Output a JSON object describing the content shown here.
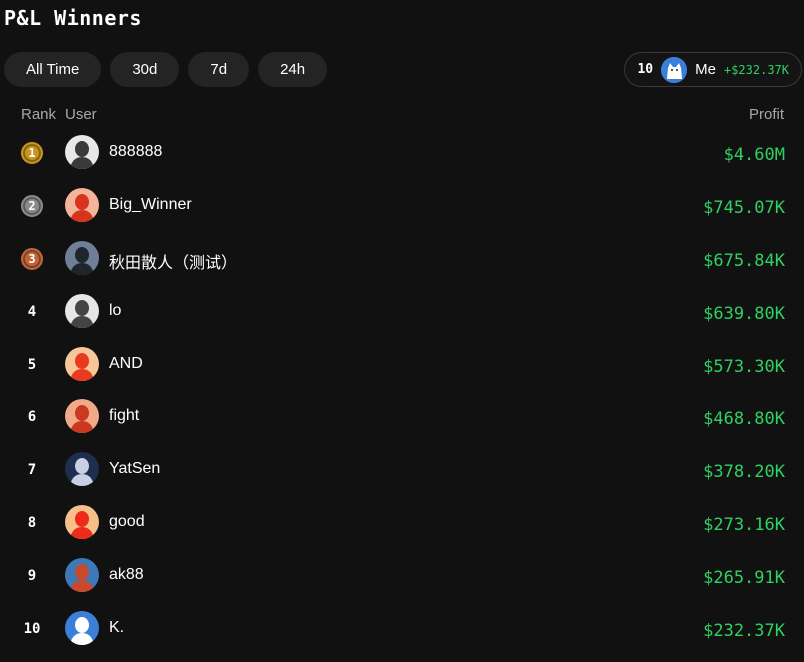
{
  "title": "P&L Winners",
  "filters": [
    {
      "label": "All Time",
      "active": true
    },
    {
      "label": "30d",
      "active": false
    },
    {
      "label": "7d",
      "active": false
    },
    {
      "label": "24h",
      "active": false
    }
  ],
  "me": {
    "rank": "10",
    "label": "Me",
    "profit": "+$232.37K",
    "avatar_icon": "cat-avatar-icon"
  },
  "columns": {
    "rank": "Rank",
    "user": "User",
    "profit": "Profit"
  },
  "colors": {
    "accent": "#f0642f",
    "profit_green": "#2fd162",
    "gold": "#c8961e",
    "silver": "#8a8a8a",
    "bronze": "#c0653a"
  },
  "rows": [
    {
      "rank": "1",
      "medal": "gold",
      "name": "888888",
      "profit": "$4.60M",
      "avatar": {
        "bg": "#e8e8e8",
        "fg": "#3a3a3a"
      }
    },
    {
      "rank": "2",
      "medal": "silver",
      "name": "Big_Winner",
      "profit": "$745.07K",
      "avatar": {
        "bg": "#f4b49a",
        "fg": "#d8331c"
      }
    },
    {
      "rank": "3",
      "medal": "bronze",
      "name": "秋田散人（测试）",
      "profit": "$675.84K",
      "avatar": {
        "bg": "#6f7f96",
        "fg": "#20242c"
      }
    },
    {
      "rank": "4",
      "medal": "",
      "name": "lo",
      "profit": "$639.80K",
      "avatar": {
        "bg": "#e6e6e6",
        "fg": "#444444"
      }
    },
    {
      "rank": "5",
      "medal": "",
      "name": "AND",
      "profit": "$573.30K",
      "avatar": {
        "bg": "#f7c79a",
        "fg": "#ea3a1e"
      }
    },
    {
      "rank": "6",
      "medal": "",
      "name": "fight",
      "profit": "$468.80K",
      "avatar": {
        "bg": "#f2a98a",
        "fg": "#c9381f"
      }
    },
    {
      "rank": "7",
      "medal": "",
      "name": "YatSen",
      "profit": "$378.20K",
      "avatar": {
        "bg": "#1f2d4e",
        "fg": "#c8d0e6"
      }
    },
    {
      "rank": "8",
      "medal": "",
      "name": "good",
      "profit": "$273.16K",
      "avatar": {
        "bg": "#f7c08a",
        "fg": "#ee2a18"
      }
    },
    {
      "rank": "9",
      "medal": "",
      "name": "ak88",
      "profit": "$265.91K",
      "avatar": {
        "bg": "#3d79b8",
        "fg": "#c94a2a"
      }
    },
    {
      "rank": "10",
      "medal": "",
      "name": "K.",
      "profit": "$232.37K",
      "avatar": {
        "bg": "#3b7fd9",
        "fg": "#ffffff"
      }
    }
  ]
}
